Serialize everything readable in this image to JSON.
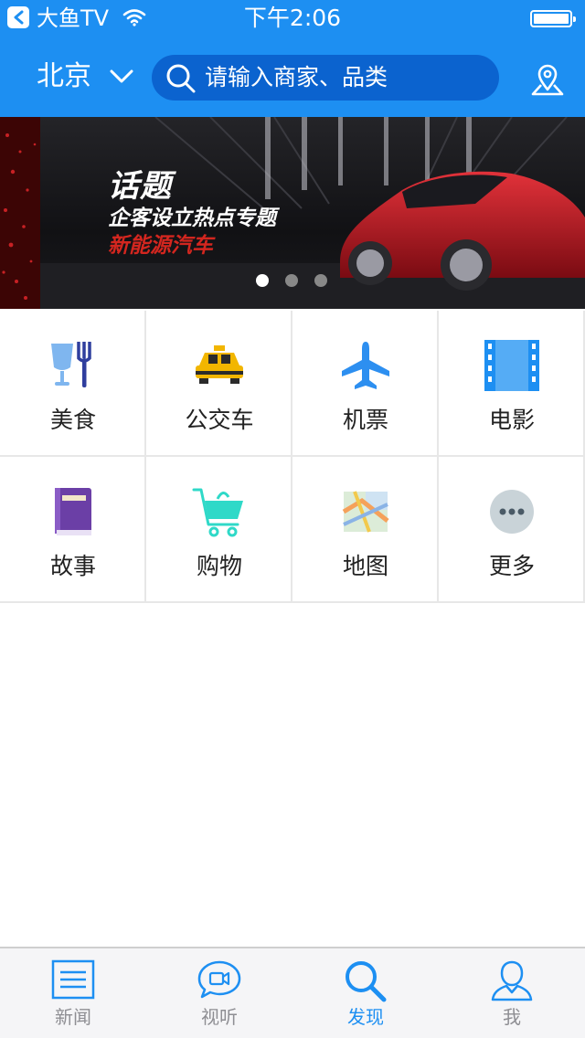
{
  "status_bar": {
    "back_app": "大鱼TV",
    "time": "下午2:06"
  },
  "nav": {
    "city": "北京",
    "search_placeholder": "请输入商家、品类"
  },
  "banner": {
    "line1": "话题",
    "line2": "企客设立热点专题",
    "line3": "新能源汽车",
    "page_count": 3,
    "active_page": 1
  },
  "categories": [
    {
      "label": "美食",
      "icon": "food-icon"
    },
    {
      "label": "公交车",
      "icon": "taxi-icon"
    },
    {
      "label": "机票",
      "icon": "airplane-icon"
    },
    {
      "label": "电影",
      "icon": "film-icon"
    },
    {
      "label": "故事",
      "icon": "book-icon"
    },
    {
      "label": "购物",
      "icon": "shopping-cart-icon"
    },
    {
      "label": "地图",
      "icon": "map-icon"
    },
    {
      "label": "更多",
      "icon": "more-icon"
    }
  ],
  "tabs": [
    {
      "label": "新闻",
      "icon": "news-icon"
    },
    {
      "label": "视听",
      "icon": "video-chat-icon"
    },
    {
      "label": "发现",
      "icon": "discover-search-icon",
      "active": true
    },
    {
      "label": "我",
      "icon": "profile-icon"
    }
  ],
  "colors": {
    "brand": "#1d8ff2",
    "search_bg": "#0b63cf",
    "tab_active": "#1d8ff2",
    "tab_inactive": "#8e8e93"
  }
}
